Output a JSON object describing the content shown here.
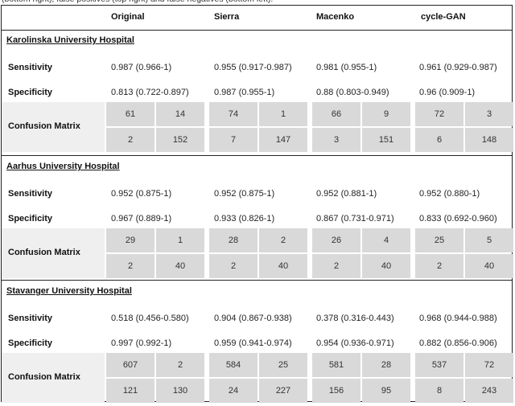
{
  "caption": "(bottom right), false positives (top right) and false negatives (bottom left).",
  "columns": [
    "Original",
    "Sierra",
    "Macenko",
    "cycle-GAN"
  ],
  "row_labels": {
    "sensitivity": "Sensitivity",
    "specificity": "Specificity",
    "confusion": "Confusion Matrix"
  },
  "sections": [
    {
      "title": "Karolinska University Hospital",
      "sensitivity": [
        "0.987 (0.966-1)",
        "0.955 (0.917-0.987)",
        "0.981 (0.955-1)",
        "0.961 (0.929-0.987)"
      ],
      "specificity": [
        "0.813 (0.722-0.897)",
        "0.987 (0.955-1)",
        "0.88 (0.803-0.949)",
        "0.96 (0.909-1)"
      ],
      "confusion": [
        {
          "tl": "61",
          "tr": "14",
          "bl": "2",
          "br": "152"
        },
        {
          "tl": "74",
          "tr": "1",
          "bl": "7",
          "br": "147"
        },
        {
          "tl": "66",
          "tr": "9",
          "bl": "3",
          "br": "151"
        },
        {
          "tl": "72",
          "tr": "3",
          "bl": "6",
          "br": "148"
        }
      ]
    },
    {
      "title": "Aarhus University Hospital",
      "sensitivity": [
        "0.952 (0.875-1)",
        "0.952 (0.875-1)",
        "0.952 (0.881-1)",
        "0.952 (0.880-1)"
      ],
      "specificity": [
        "0.967 (0.889-1)",
        "0.933 (0.826-1)",
        "0.867 (0.731-0.971)",
        "0.833 (0.692-0.960)"
      ],
      "confusion": [
        {
          "tl": "29",
          "tr": "1",
          "bl": "2",
          "br": "40"
        },
        {
          "tl": "28",
          "tr": "2",
          "bl": "2",
          "br": "40"
        },
        {
          "tl": "26",
          "tr": "4",
          "bl": "2",
          "br": "40"
        },
        {
          "tl": "25",
          "tr": "5",
          "bl": "2",
          "br": "40"
        }
      ]
    },
    {
      "title": "Stavanger University Hospital",
      "sensitivity": [
        "0.518 (0.456-0.580)",
        "0.904 (0.867-0.938)",
        "0.378 (0.316-0.443)",
        "0.968 (0.944-0.988)"
      ],
      "specificity": [
        "0.997 (0.992-1)",
        "0.959 (0.941-0.974)",
        "0.954 (0.936-0.971)",
        "0.882 (0.856-0.906)"
      ],
      "confusion": [
        {
          "tl": "607",
          "tr": "2",
          "bl": "121",
          "br": "130"
        },
        {
          "tl": "584",
          "tr": "25",
          "bl": "24",
          "br": "227"
        },
        {
          "tl": "581",
          "tr": "28",
          "bl": "156",
          "br": "95"
        },
        {
          "tl": "537",
          "tr": "72",
          "bl": "8",
          "br": "243"
        }
      ]
    }
  ]
}
